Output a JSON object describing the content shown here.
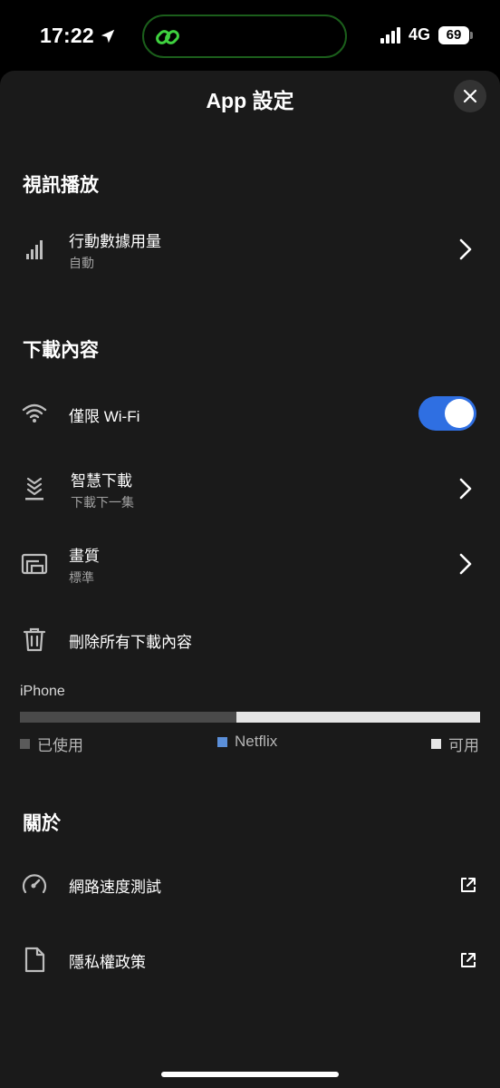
{
  "status": {
    "time": "17:22",
    "network": "4G",
    "battery": "69"
  },
  "sheet": {
    "title": "App 設定"
  },
  "sections": {
    "video": "視訊播放",
    "downloads": "下載內容",
    "about": "關於"
  },
  "rows": {
    "mobile_data": {
      "label": "行動數據用量",
      "sub": "自動",
      "icon": "signal-bars-icon"
    },
    "wifi_only": {
      "label": "僅限 Wi-Fi",
      "icon": "wifi-icon",
      "enabled": true
    },
    "smart_downloads": {
      "label": "智慧下載",
      "sub": "下載下一集",
      "icon": "smart-download-icon"
    },
    "quality": {
      "label": "畫質",
      "sub": "標準",
      "icon": "video-quality-icon"
    },
    "delete_all": {
      "label": "刪除所有下載內容",
      "icon": "trash-icon"
    },
    "speed_test": {
      "label": "網路速度測試",
      "icon": "speedometer-icon"
    },
    "privacy": {
      "label": "隱私權政策",
      "icon": "document-icon"
    }
  },
  "storage": {
    "device": "iPhone",
    "used_fraction": 0.47,
    "free_fraction": 0.53,
    "legend": {
      "used": "已使用",
      "netflix": "Netflix",
      "free": "可用"
    },
    "colors": {
      "used": "#4a4a4a",
      "netflix": "#5b8fd9",
      "free": "#e5e5e5"
    }
  },
  "colors": {
    "toggle_on": "#2f6fe2",
    "sheet_bg": "#1a1a1a"
  }
}
